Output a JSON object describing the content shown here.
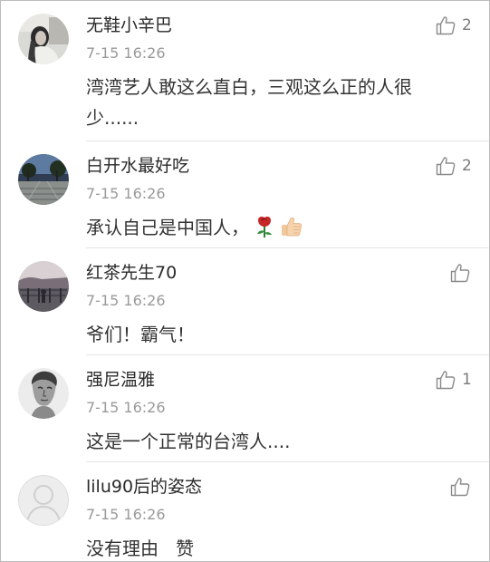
{
  "comments": [
    {
      "username": "无鞋小辛巴",
      "time": "7-15 16:26",
      "text": "湾湾艺人敢这么直白，三观这么正的人很少......",
      "likes": "2",
      "avatar": "woman-portrait-avatar"
    },
    {
      "username": "白开水最好吃",
      "time": "7-15 16:26",
      "text": "承认自己是中国人，",
      "emojis": [
        "rose-emoji",
        "thumbs-up-emoji"
      ],
      "likes": "2",
      "avatar": "park-scene-avatar"
    },
    {
      "username": "红茶先生70",
      "time": "7-15 16:26",
      "text": "爷们！霸气！",
      "likes": "",
      "avatar": "bridge-scene-avatar"
    },
    {
      "username": "强尼温雅",
      "time": "7-15 16:26",
      "text": "这是一个正常的台湾人....",
      "likes": "1",
      "avatar": "statue-bust-avatar"
    },
    {
      "username": "lilu90后的姿态",
      "time": "7-15 16:26",
      "text": "没有理由   赞",
      "likes": "",
      "avatar": "default-user-avatar"
    }
  ],
  "colors": {
    "username": "#2a2a2a",
    "timestamp": "#9a9a9a",
    "divider": "#e4e4e4",
    "like_icon": "#8a8a8a"
  }
}
